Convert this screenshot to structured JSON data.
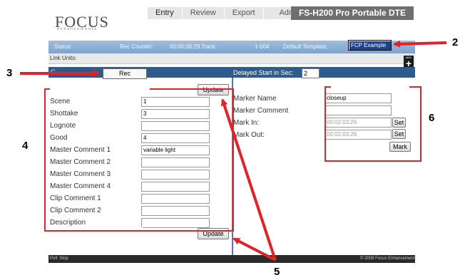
{
  "header": {
    "logo": "FOCUS",
    "logo_sub": "enhancements",
    "tabs": [
      "Entry",
      "Review",
      "Export",
      "Admin"
    ],
    "product": "FS-H200 Pro Portable DTE"
  },
  "status_bar": {
    "status_label": "Status:",
    "rec_counter_label": "Rec Counter:",
    "rec_counter_value": "00:00:06:29",
    "track_label": "Track:",
    "track_value": "1-004",
    "template_label": "Default Template:",
    "template_value": "FCP Example"
  },
  "link_units_label": "Link Units:",
  "add_button": {
    "label": "ADD",
    "symbol": "+"
  },
  "rec_bar": {
    "left_label": "C",
    "rec_label": "Rec",
    "delayed_label": "Delayed Start in Sec:",
    "delayed_value": "2"
  },
  "left_panel": {
    "update_label": "Update",
    "fields": [
      {
        "label": "Scene",
        "value": "1"
      },
      {
        "label": "Shottake",
        "value": "3"
      },
      {
        "label": "Lognote",
        "value": ""
      },
      {
        "label": "Good",
        "value": "4"
      },
      {
        "label": "Master Comment 1",
        "value": "variable light"
      },
      {
        "label": "Master Comment 2",
        "value": ""
      },
      {
        "label": "Master Comment 3",
        "value": ""
      },
      {
        "label": "Master Comment 4",
        "value": ""
      },
      {
        "label": "Clip Comment 1",
        "value": ""
      },
      {
        "label": "Clip Comment 2",
        "value": ""
      },
      {
        "label": "Description",
        "value": ""
      }
    ]
  },
  "right_panel": {
    "marker_name_label": "Marker Name",
    "marker_name_value": "closeup",
    "marker_comment_label": "Marker Comment",
    "marker_comment_value": "",
    "mark_in_label": "Mark In:",
    "mark_in_value": "00:02:03:26",
    "mark_out_label": "Mark Out:",
    "mark_out_value": "00:02:03:26",
    "set_label": "Set",
    "mark_label": "Mark"
  },
  "footer": {
    "poll": "Poll: Stop",
    "copyright": "© 2008 Focus Enhancements"
  },
  "callouts": [
    "2",
    "3",
    "4",
    "5",
    "6"
  ],
  "colors": {
    "annotation": "#e0232b",
    "bar_blue": "#2f5b8a",
    "status_blue": "#8fb0d5"
  }
}
